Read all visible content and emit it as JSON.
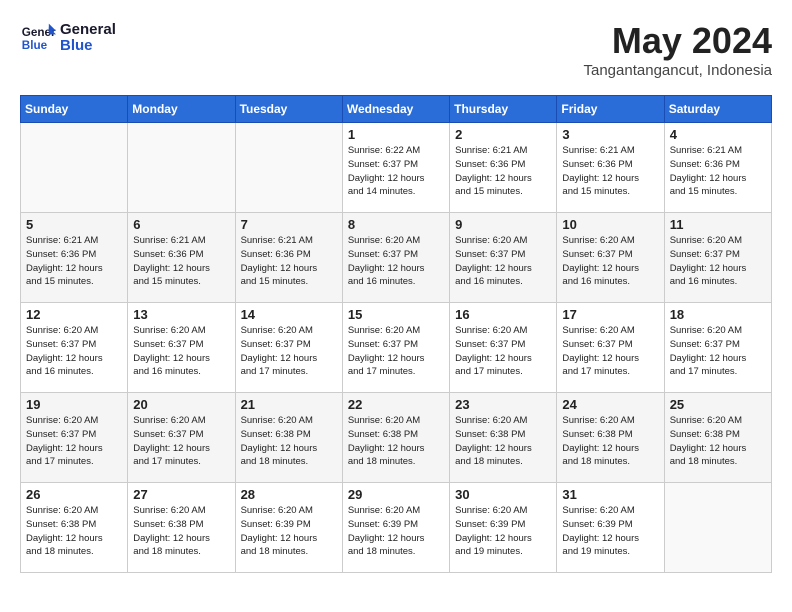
{
  "logo": {
    "line1": "General",
    "line2": "Blue"
  },
  "header": {
    "month_year": "May 2024",
    "location": "Tangantangancut, Indonesia"
  },
  "days_of_week": [
    "Sunday",
    "Monday",
    "Tuesday",
    "Wednesday",
    "Thursday",
    "Friday",
    "Saturday"
  ],
  "weeks": [
    [
      {
        "day": "",
        "info": ""
      },
      {
        "day": "",
        "info": ""
      },
      {
        "day": "",
        "info": ""
      },
      {
        "day": "1",
        "info": "Sunrise: 6:22 AM\nSunset: 6:37 PM\nDaylight: 12 hours\nand 14 minutes."
      },
      {
        "day": "2",
        "info": "Sunrise: 6:21 AM\nSunset: 6:36 PM\nDaylight: 12 hours\nand 15 minutes."
      },
      {
        "day": "3",
        "info": "Sunrise: 6:21 AM\nSunset: 6:36 PM\nDaylight: 12 hours\nand 15 minutes."
      },
      {
        "day": "4",
        "info": "Sunrise: 6:21 AM\nSunset: 6:36 PM\nDaylight: 12 hours\nand 15 minutes."
      }
    ],
    [
      {
        "day": "5",
        "info": "Sunrise: 6:21 AM\nSunset: 6:36 PM\nDaylight: 12 hours\nand 15 minutes."
      },
      {
        "day": "6",
        "info": "Sunrise: 6:21 AM\nSunset: 6:36 PM\nDaylight: 12 hours\nand 15 minutes."
      },
      {
        "day": "7",
        "info": "Sunrise: 6:21 AM\nSunset: 6:36 PM\nDaylight: 12 hours\nand 15 minutes."
      },
      {
        "day": "8",
        "info": "Sunrise: 6:20 AM\nSunset: 6:37 PM\nDaylight: 12 hours\nand 16 minutes."
      },
      {
        "day": "9",
        "info": "Sunrise: 6:20 AM\nSunset: 6:37 PM\nDaylight: 12 hours\nand 16 minutes."
      },
      {
        "day": "10",
        "info": "Sunrise: 6:20 AM\nSunset: 6:37 PM\nDaylight: 12 hours\nand 16 minutes."
      },
      {
        "day": "11",
        "info": "Sunrise: 6:20 AM\nSunset: 6:37 PM\nDaylight: 12 hours\nand 16 minutes."
      }
    ],
    [
      {
        "day": "12",
        "info": "Sunrise: 6:20 AM\nSunset: 6:37 PM\nDaylight: 12 hours\nand 16 minutes."
      },
      {
        "day": "13",
        "info": "Sunrise: 6:20 AM\nSunset: 6:37 PM\nDaylight: 12 hours\nand 16 minutes."
      },
      {
        "day": "14",
        "info": "Sunrise: 6:20 AM\nSunset: 6:37 PM\nDaylight: 12 hours\nand 17 minutes."
      },
      {
        "day": "15",
        "info": "Sunrise: 6:20 AM\nSunset: 6:37 PM\nDaylight: 12 hours\nand 17 minutes."
      },
      {
        "day": "16",
        "info": "Sunrise: 6:20 AM\nSunset: 6:37 PM\nDaylight: 12 hours\nand 17 minutes."
      },
      {
        "day": "17",
        "info": "Sunrise: 6:20 AM\nSunset: 6:37 PM\nDaylight: 12 hours\nand 17 minutes."
      },
      {
        "day": "18",
        "info": "Sunrise: 6:20 AM\nSunset: 6:37 PM\nDaylight: 12 hours\nand 17 minutes."
      }
    ],
    [
      {
        "day": "19",
        "info": "Sunrise: 6:20 AM\nSunset: 6:37 PM\nDaylight: 12 hours\nand 17 minutes."
      },
      {
        "day": "20",
        "info": "Sunrise: 6:20 AM\nSunset: 6:37 PM\nDaylight: 12 hours\nand 17 minutes."
      },
      {
        "day": "21",
        "info": "Sunrise: 6:20 AM\nSunset: 6:38 PM\nDaylight: 12 hours\nand 18 minutes."
      },
      {
        "day": "22",
        "info": "Sunrise: 6:20 AM\nSunset: 6:38 PM\nDaylight: 12 hours\nand 18 minutes."
      },
      {
        "day": "23",
        "info": "Sunrise: 6:20 AM\nSunset: 6:38 PM\nDaylight: 12 hours\nand 18 minutes."
      },
      {
        "day": "24",
        "info": "Sunrise: 6:20 AM\nSunset: 6:38 PM\nDaylight: 12 hours\nand 18 minutes."
      },
      {
        "day": "25",
        "info": "Sunrise: 6:20 AM\nSunset: 6:38 PM\nDaylight: 12 hours\nand 18 minutes."
      }
    ],
    [
      {
        "day": "26",
        "info": "Sunrise: 6:20 AM\nSunset: 6:38 PM\nDaylight: 12 hours\nand 18 minutes."
      },
      {
        "day": "27",
        "info": "Sunrise: 6:20 AM\nSunset: 6:38 PM\nDaylight: 12 hours\nand 18 minutes."
      },
      {
        "day": "28",
        "info": "Sunrise: 6:20 AM\nSunset: 6:39 PM\nDaylight: 12 hours\nand 18 minutes."
      },
      {
        "day": "29",
        "info": "Sunrise: 6:20 AM\nSunset: 6:39 PM\nDaylight: 12 hours\nand 18 minutes."
      },
      {
        "day": "30",
        "info": "Sunrise: 6:20 AM\nSunset: 6:39 PM\nDaylight: 12 hours\nand 19 minutes."
      },
      {
        "day": "31",
        "info": "Sunrise: 6:20 AM\nSunset: 6:39 PM\nDaylight: 12 hours\nand 19 minutes."
      },
      {
        "day": "",
        "info": ""
      }
    ]
  ]
}
